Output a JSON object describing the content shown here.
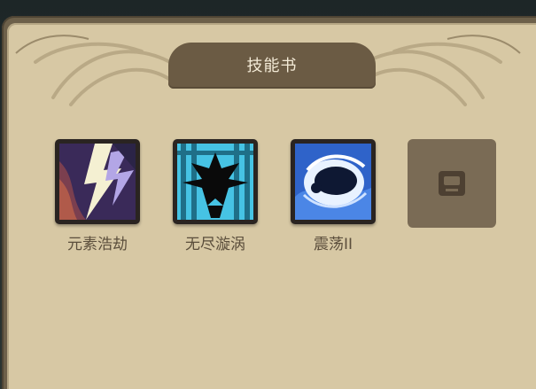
{
  "panel": {
    "title": "技能书"
  },
  "skills": [
    {
      "name": "元素浩劫",
      "icon": "lightning-storm-icon"
    },
    {
      "name": "无尽漩涡",
      "icon": "endless-vortex-icon"
    },
    {
      "name": "震荡II",
      "icon": "shock-wave-icon"
    }
  ],
  "locked_slot": {
    "icon": "lock-icon"
  },
  "colors": {
    "panel_bg": "#d7c8a4",
    "frame": "#6d604a",
    "banner": "#6b5b44",
    "label_text": "#5b4e3c",
    "locked_slot": "#7a6b55"
  }
}
